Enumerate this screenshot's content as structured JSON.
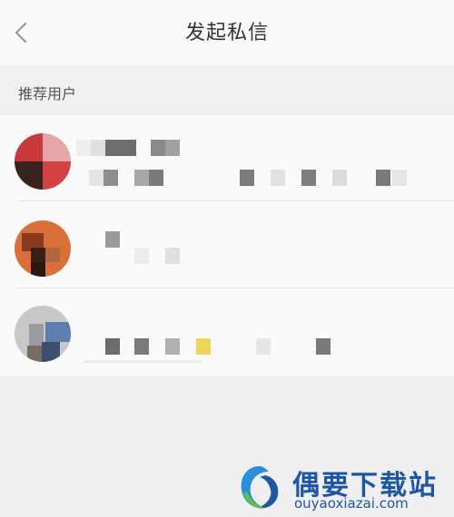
{
  "header": {
    "back_icon": "chevron-left-icon",
    "title": "发起私信"
  },
  "section": {
    "title": "推荐用户"
  },
  "users": [
    {
      "avatar_colors": [
        "#c9383a",
        "#d14043",
        "#3a2220",
        "#8a5a4a"
      ],
      "name": "",
      "bio": ""
    },
    {
      "avatar_colors": [
        "#d9703a",
        "#3b1f16",
        "#8b3a22",
        "#b0673f"
      ],
      "name": "",
      "bio": ""
    },
    {
      "avatar_colors": [
        "#c8c8c8",
        "#5b7fae",
        "#7a6a60",
        "#9a9aa0"
      ],
      "name": "",
      "bio": ""
    }
  ],
  "watermark": {
    "brand": "偶要下载站",
    "url": "ouyaoxiazai.com",
    "logo_icon": "ouyao-logo-icon",
    "brand_color": "#1e56a6"
  }
}
